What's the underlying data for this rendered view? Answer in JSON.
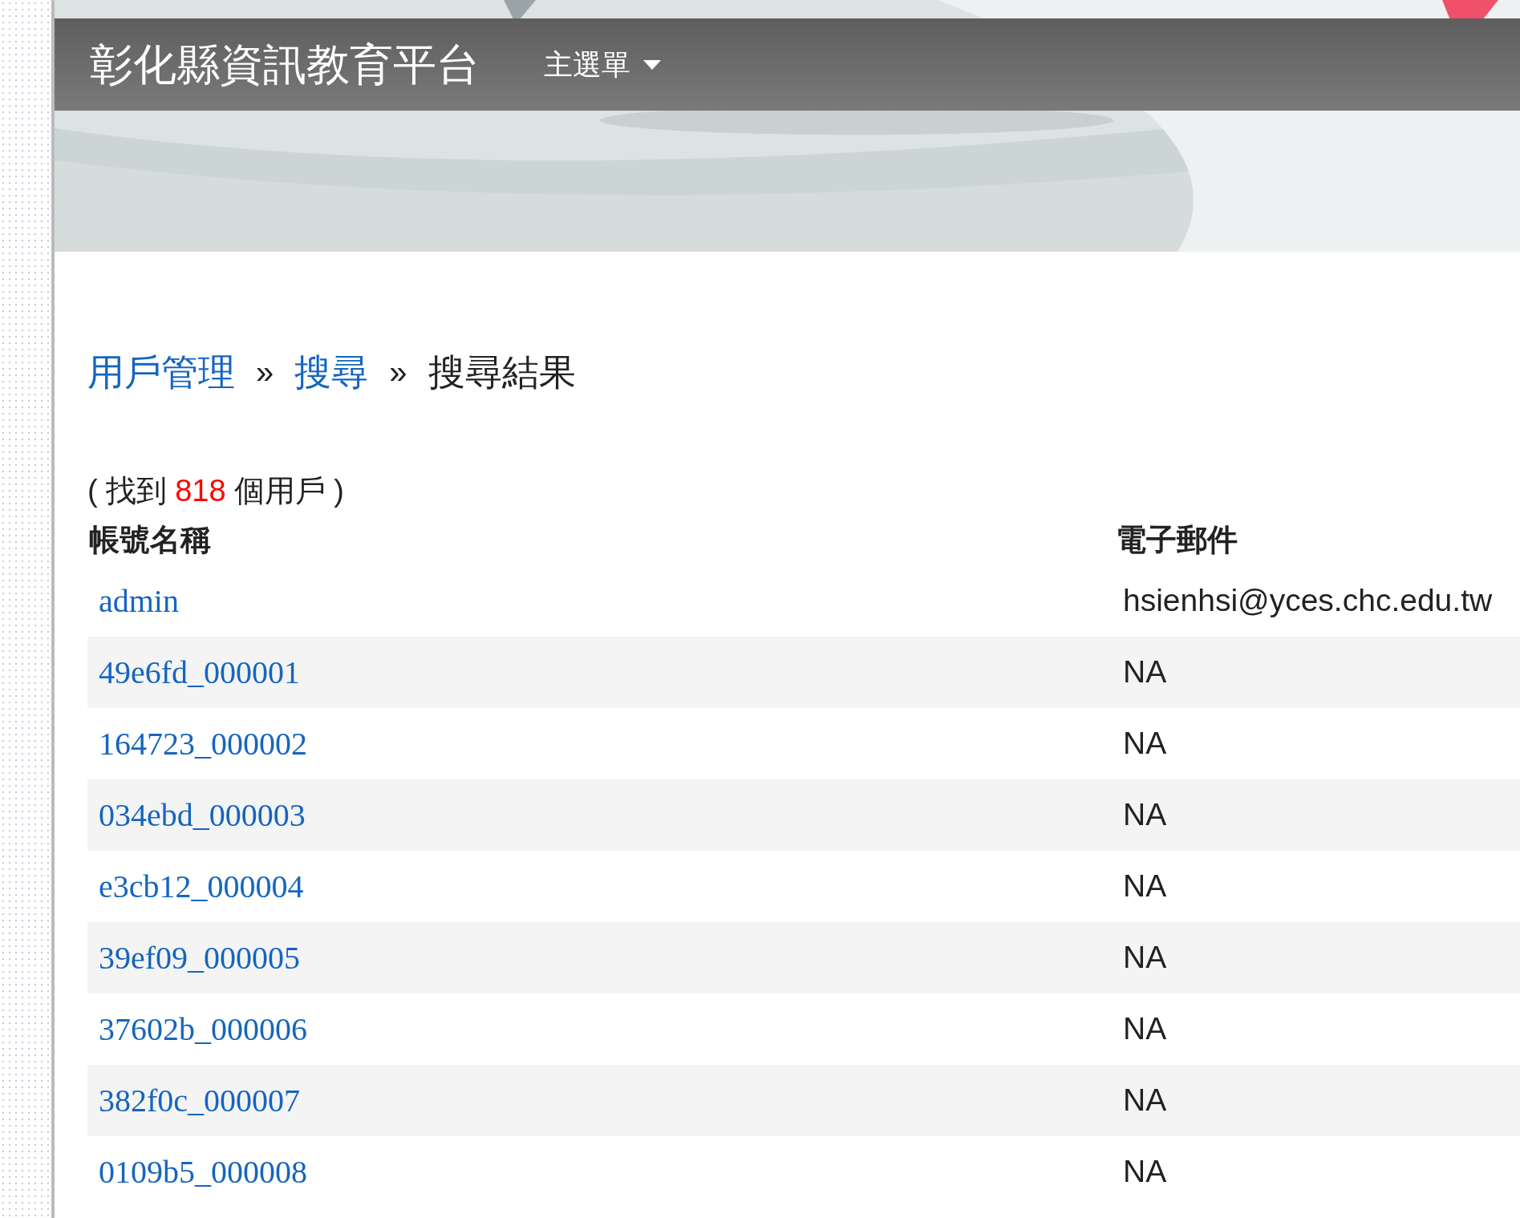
{
  "navbar": {
    "brand": "彰化縣資訊教育平台",
    "menu": {
      "label": "主選單",
      "expanded": false
    }
  },
  "breadcrumb": [
    {
      "label": "用戶管理",
      "kind": "link"
    },
    {
      "label": "»",
      "kind": "separator"
    },
    {
      "label": "搜尋",
      "kind": "link"
    },
    {
      "label": "»",
      "kind": "separator"
    },
    {
      "label": "搜尋結果",
      "kind": "current"
    }
  ],
  "result_count": {
    "before": "( 找到",
    "count": "818",
    "after": "個用戶 )"
  },
  "table": {
    "columns": [
      "帳號名稱",
      "電子郵件"
    ],
    "rows": [
      {
        "account": "admin",
        "email": "hsienhsi@yces.chc.edu.tw"
      },
      {
        "account": "49e6fd_000001",
        "email": "NA"
      },
      {
        "account": "164723_000002",
        "email": "NA"
      },
      {
        "account": "034ebd_000003",
        "email": "NA"
      },
      {
        "account": "e3cb12_000004",
        "email": "NA"
      },
      {
        "account": "39ef09_000005",
        "email": "NA"
      },
      {
        "account": "37602b_000006",
        "email": "NA"
      },
      {
        "account": "382f0c_000007",
        "email": "NA"
      },
      {
        "account": "0109b5_000008",
        "email": "NA"
      }
    ]
  }
}
